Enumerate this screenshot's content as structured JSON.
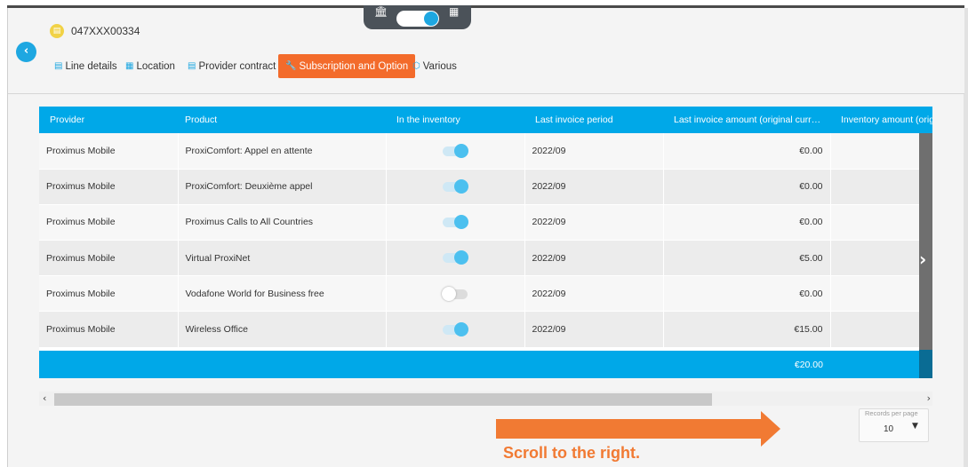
{
  "header": {
    "sim_icon": "sim-card-icon",
    "sim_number": "047XXX00334",
    "view_toggle": {
      "left_icon": "bank-icon",
      "right_icon": "building-icon",
      "state": "on"
    },
    "back_icon": "chevron-left-icon"
  },
  "tabs": [
    {
      "label": "Line details",
      "icon": "document-icon",
      "active": false
    },
    {
      "label": "Location",
      "icon": "building-icon",
      "active": false
    },
    {
      "label": "Provider contract",
      "icon": "document-icon",
      "active": false
    },
    {
      "label": "Subscription and Option",
      "icon": "wrench-icon",
      "active": true
    },
    {
      "label": "Various",
      "icon": "cube-icon",
      "active": false
    }
  ],
  "table": {
    "columns": [
      "Provider",
      "Product",
      "In the inventory",
      "Last invoice period",
      "Last invoice amount (original curren…",
      "Inventory amount (origi"
    ],
    "rows": [
      {
        "provider": "Proximus Mobile",
        "product": "ProxiComfort: Appel en attente",
        "in_inventory": true,
        "period": "2022/09",
        "amount": "€0.00"
      },
      {
        "provider": "Proximus Mobile",
        "product": "ProxiComfort: Deuxième appel",
        "in_inventory": true,
        "period": "2022/09",
        "amount": "€0.00"
      },
      {
        "provider": "Proximus Mobile",
        "product": "Proximus Calls to All Countries",
        "in_inventory": true,
        "period": "2022/09",
        "amount": "€0.00"
      },
      {
        "provider": "Proximus Mobile",
        "product": "Virtual ProxiNet",
        "in_inventory": true,
        "period": "2022/09",
        "amount": "€5.00"
      },
      {
        "provider": "Proximus Mobile",
        "product": "Vodafone World for Business free",
        "in_inventory": false,
        "period": "2022/09",
        "amount": "€0.00"
      },
      {
        "provider": "Proximus Mobile",
        "product": "Wireless Office",
        "in_inventory": true,
        "period": "2022/09",
        "amount": "€15.00"
      }
    ],
    "total": "€20.00",
    "scroll_right_icon": "chevron-right-icon"
  },
  "scrollbar": {
    "left_icon": "chevron-left-icon",
    "right_icon": "chevron-right-icon"
  },
  "annotation": {
    "text": "Scroll to the right.",
    "color": "#f17a33"
  },
  "pagination": {
    "label": "Records per page",
    "value": "10",
    "caret_icon": "caret-down-icon"
  },
  "colors": {
    "accent": "#00a8e8",
    "active_tab": "#f36b2b",
    "sim_icon": "#f1d246"
  }
}
